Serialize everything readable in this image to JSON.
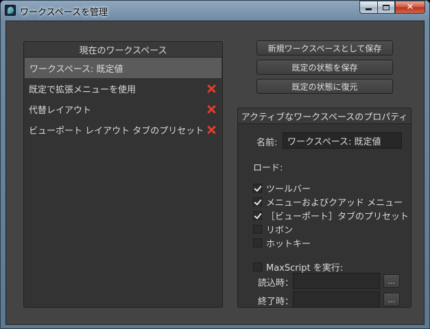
{
  "window": {
    "title": "ワークスペースを管理"
  },
  "workspaces": {
    "header": "現在のワークスペース",
    "items": [
      {
        "label": "ワークスペース: 既定値",
        "selected": true,
        "deletable": false
      },
      {
        "label": "既定で拡張メニューを使用",
        "selected": false,
        "deletable": true
      },
      {
        "label": "代替レイアウト",
        "selected": false,
        "deletable": true
      },
      {
        "label": "ビューポート レイアウト タブのプリセット",
        "selected": false,
        "deletable": true
      }
    ]
  },
  "actions": {
    "save_new": "新規ワークスペースとして保存",
    "save_default": "既定の状態を保存",
    "restore_default": "既定の状態に復元"
  },
  "properties": {
    "header": "アクティブなワークスペースのプロパティ",
    "name_label": "名前:",
    "name_value": "ワークスペース: 既定値",
    "load_label": "ロード:",
    "load_options": [
      {
        "label": "ツールバー",
        "checked": true
      },
      {
        "label": "メニューおよびクアッド メニュー",
        "checked": true
      },
      {
        "label": "［ビューポート］タブのプリセット",
        "checked": true
      },
      {
        "label": "リボン",
        "checked": false
      },
      {
        "label": "ホットキー",
        "checked": false
      }
    ],
    "maxscript_label": "MaxScript を実行:",
    "maxscript_checked": false,
    "on_load_label": "読込時：",
    "on_exit_label": "終了時：",
    "browse_label": "..."
  }
}
